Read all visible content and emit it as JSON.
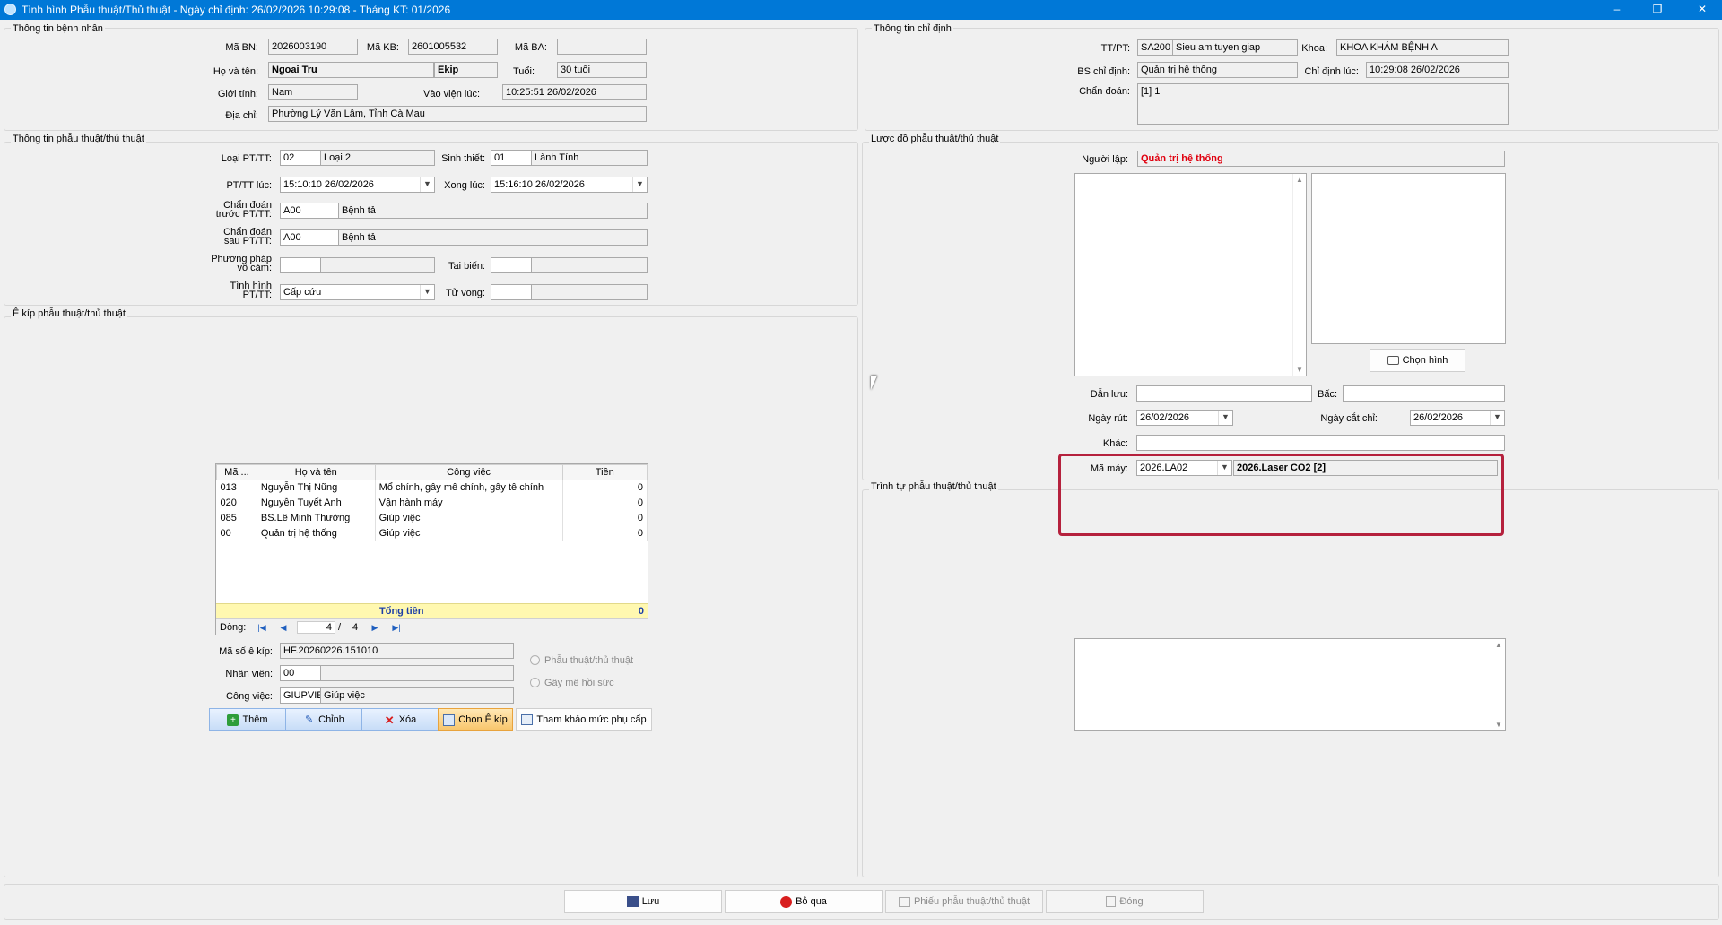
{
  "window": {
    "title": "Tình hình Phẫu thuật/Thủ thuật - Ngày chỉ định: 26/02/2026 10:29:08 - Tháng KT: 01/2026",
    "minimize": "–",
    "restore": "❐",
    "close": "✕"
  },
  "patient": {
    "group": "Thông tin bệnh nhân",
    "ma_bn_label": "Mã BN:",
    "ma_bn": "2026003190",
    "ma_kb_label": "Mã KB:",
    "ma_kb": "2601005532",
    "ma_ba_label": "Mã BA:",
    "ma_ba": "",
    "ho_ten_label": "Họ và tên:",
    "ho_ten": "Ngoai Tru",
    "ekip": "Ekip",
    "tuoi_label": "Tuổi:",
    "tuoi": "30 tuổi",
    "gioi_tinh_label": "Giới tính:",
    "gioi_tinh": "Nam",
    "vao_vien_label": "Vào viện lúc:",
    "vao_vien": "10:25:51 26/02/2026",
    "dia_chi_label": "Địa chỉ:",
    "dia_chi": "Phường Lý Văn Lâm, Tỉnh Cà Mau"
  },
  "order": {
    "group": "Thông tin chỉ định",
    "ttpt_label": "TT/PT:",
    "ttpt_code": "SA200",
    "ttpt_name": "Sieu am tuyen giap",
    "khoa_label": "Khoa:",
    "khoa": "KHOA KHÁM BỆNH A",
    "bs_label": "BS chỉ định:",
    "bs": "Quản trị hệ thống",
    "chi_dinh_label": "Chỉ định lúc:",
    "chi_dinh": "10:29:08 26/02/2026",
    "chan_doan_label": "Chẩn đoán:",
    "chan_doan": "[1] 1"
  },
  "surgery": {
    "group": "Thông tin phẫu thuật/thủ thuật",
    "loai_label": "Loại PT/TT:",
    "loai_code": "02",
    "loai_name": "Loại 2",
    "sinh_thiet_label": "Sinh thiết:",
    "sinh_thiet_code": "01",
    "sinh_thiet_name": "Lành Tính",
    "pt_luc_label": "PT/TT lúc:",
    "pt_luc": "15:10:10 26/02/2026",
    "xong_luc_label": "Xong lúc:",
    "xong_luc": "15:16:10 26/02/2026",
    "cd_truoc_label1": "Chẩn đoán",
    "cd_truoc_label2": "trước PT/TT:",
    "cd_truoc_code": "A00",
    "cd_truoc_name": "Bệnh tả",
    "cd_sau_label1": "Chẩn đoán",
    "cd_sau_label2": "sau PT/TT:",
    "cd_sau_code": "A00",
    "cd_sau_name": "Bệnh tả",
    "vo_cam_label1": "Phương pháp",
    "vo_cam_label2": "vô cảm:",
    "tai_bien_label": "Tai biến:",
    "tinh_hinh_label1": "Tình hình",
    "tinh_hinh_label2": "PT/TT:",
    "tinh_hinh": "Cấp cứu",
    "tu_vong_label": "Tử vong:"
  },
  "ekip": {
    "group": "Ê kíp phẫu thuật/thủ thuật",
    "columns": [
      "Mã ...",
      "Họ và tên",
      "Công việc",
      "Tiền"
    ],
    "rows": [
      [
        "013",
        "Nguyễn Thị Nũng",
        "Mổ chính, gây mê chính, gây tê chính",
        "0"
      ],
      [
        "020",
        "Nguyễn Tuyết Anh",
        "Vận hành máy",
        "0"
      ],
      [
        "085",
        "BS.Lê Minh Thường",
        "Giúp việc",
        "0"
      ],
      [
        "00",
        "Quản trị hệ thống",
        "Giúp việc",
        "0"
      ]
    ],
    "total_label": "Tổng tiền",
    "total": "0",
    "dong_label": "Dòng:",
    "page_current": "4",
    "page_sep": "/",
    "page_total": "4",
    "ma_ekip_label": "Mã số ê kíp:",
    "ma_ekip": "HF.20260226.151010",
    "nhan_vien_label": "Nhân viên:",
    "nhan_vien": "00",
    "cong_viec_label": "Công việc:",
    "cong_viec_code": "GIUPVIEC",
    "cong_viec_name": "Giúp việc",
    "radio1": "Phẫu thuật/thủ thuật",
    "radio2": "Gây mê hồi sức",
    "btn_them": "Thêm",
    "btn_chinh": "Chỉnh",
    "btn_xoa": "Xóa",
    "btn_chon": "Chọn Ê kíp",
    "btn_tham_khao": "Tham khảo mức phụ cấp"
  },
  "diagram": {
    "group": "Lược đồ phẫu thuật/thủ thuật",
    "nguoi_lap_label": "Người lập:",
    "nguoi_lap": "Quản trị hệ thống",
    "chon_hinh": "Chọn hình",
    "dan_luu_label": "Dẫn lưu:",
    "bac_label": "Bấc:",
    "ngay_rut_label": "Ngày rút:",
    "ngay_rut": "26/02/2026",
    "ngay_cat_chi_label": "Ngày cắt chỉ:",
    "ngay_cat_chi": "26/02/2026",
    "khac_label": "Khác:",
    "ma_may_label": "Mã máy:",
    "ma_may": "2026.LA02",
    "ma_may_name": "2026.Laser CO2 [2]"
  },
  "sequence": {
    "group": "Trình tự phẫu thuật/thủ thuật"
  },
  "footer": {
    "luu": "Lưu",
    "bo_qua": "Bỏ qua",
    "phieu": "Phiếu phẫu thuật/thủ thuật",
    "dong": "Đóng"
  },
  "colors": {
    "titlebar": "#0078d7",
    "highlight": "#b5213d",
    "total_row": "#fff8b0",
    "red_text": "#e0000f"
  }
}
